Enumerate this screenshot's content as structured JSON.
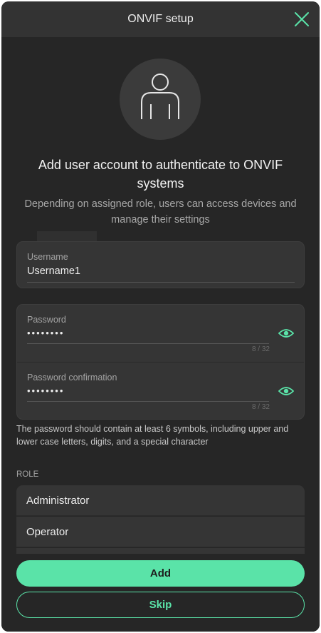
{
  "header": {
    "title": "ONVIF setup",
    "close_icon": "close-icon"
  },
  "avatar": {
    "icon": "user-icon"
  },
  "intro": {
    "title": "Add user account to authenticate to ONVIF systems",
    "subtitle": "Depending on assigned role, users can access devices and manage their settings"
  },
  "form": {
    "username": {
      "label": "Username",
      "value": "Username1"
    },
    "password": {
      "label": "Password",
      "value": "••••••••",
      "counter": "8 / 32",
      "visibility_icon": "eye-icon"
    },
    "password_confirmation": {
      "label": "Password confirmation",
      "value": "••••••••",
      "counter": "8 / 32",
      "visibility_icon": "eye-icon"
    },
    "hint": "The password should contain at least 6 symbols, including upper and lower case letters, digits, and a special character"
  },
  "role": {
    "section_label": "ROLE",
    "items": [
      {
        "label": "Administrator"
      },
      {
        "label": "Operator"
      }
    ]
  },
  "footer": {
    "add_label": "Add",
    "skip_label": "Skip"
  },
  "colors": {
    "accent": "#5ae3a8",
    "background": "#262626",
    "card": "#353535",
    "header": "#333333"
  }
}
